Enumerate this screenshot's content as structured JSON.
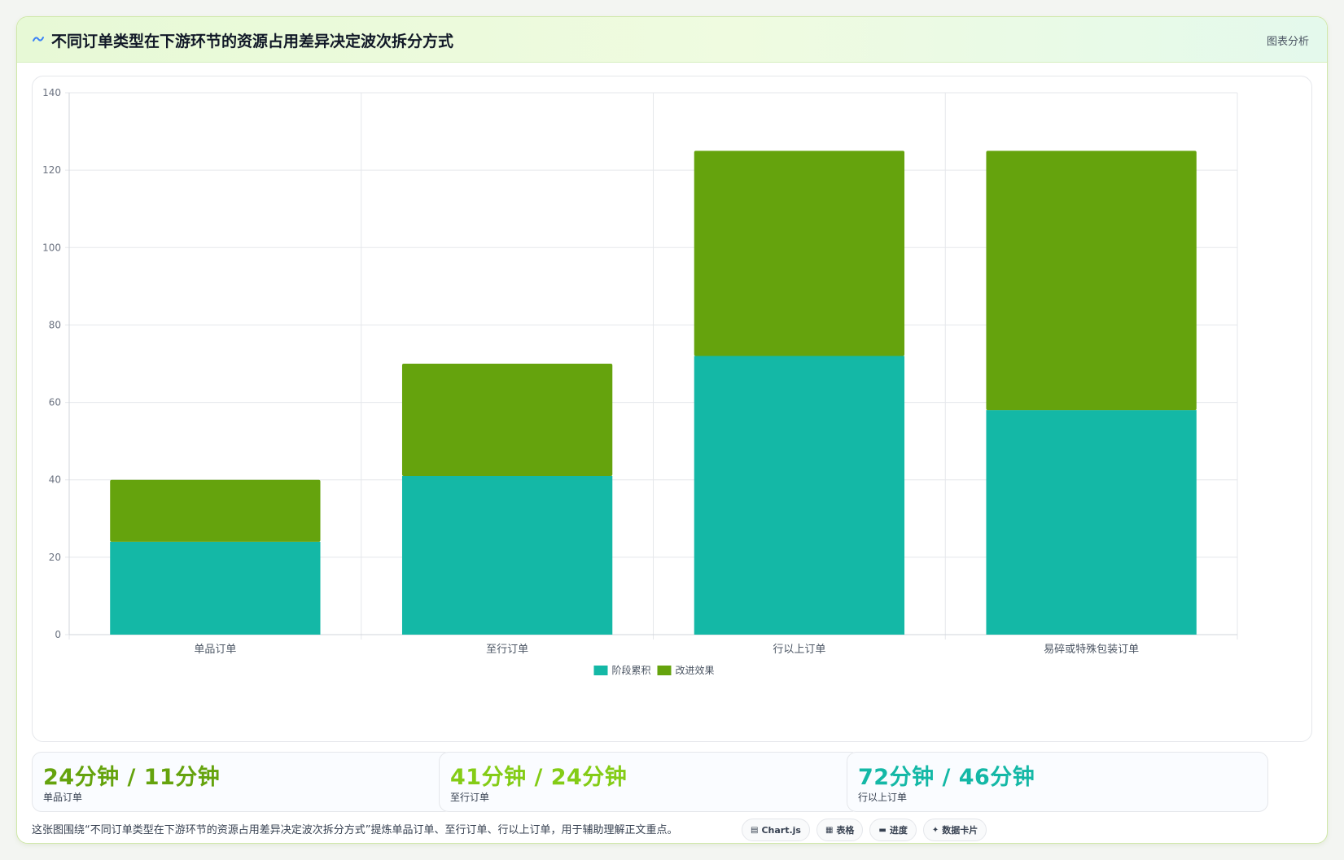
{
  "header": {
    "title": "不同订单类型在下游环节的资源占用差异决定波次拆分方式",
    "right_label": "图表分析",
    "icon": "wave-icon"
  },
  "chart_data": {
    "type": "bar",
    "stacked": true,
    "categories": [
      "单品订单",
      "至行订单",
      "行以上订单",
      "易碎或特殊包装订单"
    ],
    "series": [
      {
        "name": "阶段累积",
        "values": [
          24,
          41,
          72,
          58
        ],
        "color": "#14b8a6"
      },
      {
        "name": "改进效果",
        "values": [
          16,
          29,
          53,
          67
        ],
        "color": "#65a30d"
      }
    ],
    "ylim": [
      0,
      140
    ],
    "yticks": [
      0,
      20,
      40,
      60,
      80,
      100,
      120,
      140
    ],
    "grid": true,
    "legend_position": "bottom"
  },
  "stats": [
    {
      "value": "24分钟 / 11分钟",
      "label": "单品订单",
      "color": "#65a30d"
    },
    {
      "value": "41分钟 / 24分钟",
      "label": "至行订单",
      "color": "#84cc16"
    },
    {
      "value": "72分钟 / 46分钟",
      "label": "行以上订单",
      "color": "#14b8a6"
    }
  ],
  "footer": {
    "description": "这张图围绕“不同订单类型在下游环节的资源占用差异决定波次拆分方式”提炼单品订单、至行订单、行以上订单，用于辅助理解正文重点。",
    "chips": [
      {
        "label": "Chart.js",
        "icon": "chart-icon"
      },
      {
        "label": "表格",
        "icon": "table-icon"
      },
      {
        "label": "进度",
        "icon": "progress-icon"
      },
      {
        "label": "数据卡片",
        "icon": "sparkle-icon"
      }
    ]
  }
}
